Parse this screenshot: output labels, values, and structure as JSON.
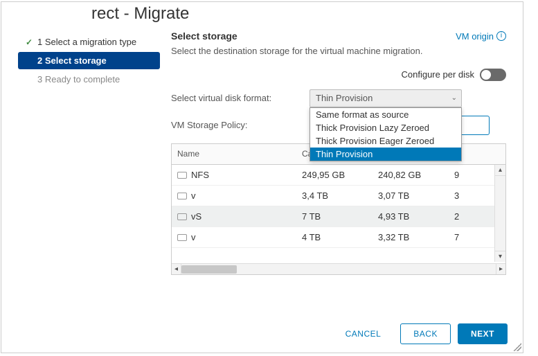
{
  "title": "rect - Migrate",
  "steps": [
    {
      "label": "1 Select a migration type",
      "state": "done"
    },
    {
      "label": "2 Select storage",
      "state": "active"
    },
    {
      "label": "3 Ready to complete",
      "state": "pending"
    }
  ],
  "main": {
    "heading": "Select storage",
    "vm_origin": "VM origin",
    "desc": "Select the destination storage for the virtual machine migration.",
    "configure_per_disk": "Configure per disk",
    "disk_format_label": "Select virtual disk format:",
    "disk_format_value": "Thin Provision",
    "disk_format_options": [
      "Same format as source",
      "Thick Provision Lazy Zeroed",
      "Thick Provision Eager Zeroed",
      "Thin Provision"
    ],
    "storage_policy_label": "VM Storage Policy:"
  },
  "table": {
    "columns": {
      "name": "Name",
      "capacity": "Cap",
      "provisioned": "",
      "free": ""
    },
    "rows": [
      {
        "name": "NFS",
        "capacity": "249,95 GB",
        "provisioned": "240,82 GB",
        "free": "9"
      },
      {
        "name": "v",
        "capacity": "3,4 TB",
        "provisioned": "3,07 TB",
        "free": "3"
      },
      {
        "name": "vS",
        "capacity": "7 TB",
        "provisioned": "4,93 TB",
        "free": "2",
        "selected": true
      },
      {
        "name": "v",
        "capacity": "4 TB",
        "provisioned": "3,32 TB",
        "free": "7"
      }
    ]
  },
  "footer": {
    "cancel": "CANCEL",
    "back": "BACK",
    "next": "NEXT"
  }
}
